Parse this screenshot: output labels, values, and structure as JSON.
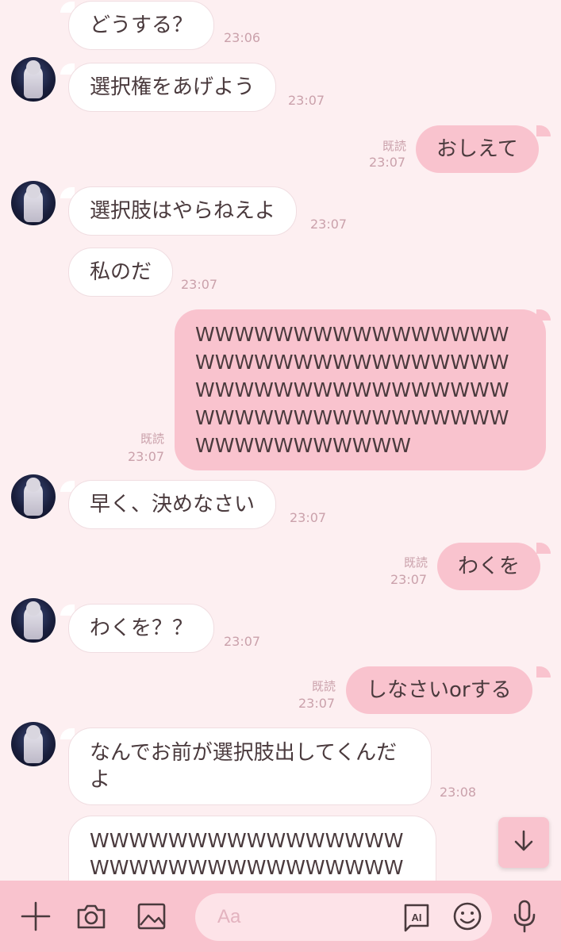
{
  "messages": [
    {
      "side": "in",
      "text": "どうする？",
      "time": "23:06"
    },
    {
      "side": "in",
      "text": "選択権をあげよう",
      "time": "23:07"
    },
    {
      "side": "out",
      "text": "おしえて",
      "time": "23:07",
      "read": "既読"
    },
    {
      "side": "in",
      "text": "選択肢はやらねえよ",
      "time": "23:07"
    },
    {
      "side": "in",
      "text": "私のだ",
      "time": "23:07"
    },
    {
      "side": "out",
      "text": "WWWWWWWWWWWWWWWWWWWWWWWWWWWWWWWWWWWWWWWWWWWWWWWWWWWWWWWWWWWWWWWWWWWWWWWWWWW",
      "time": "23:07",
      "read": "既読"
    },
    {
      "side": "in",
      "text": "早く、決めなさい",
      "time": "23:07"
    },
    {
      "side": "out",
      "text": "わくを",
      "time": "23:07",
      "read": "既読"
    },
    {
      "side": "in",
      "text": "わくを？？",
      "time": "23:07"
    },
    {
      "side": "out",
      "text": "しなさいorする",
      "time": "23:07",
      "read": "既読"
    },
    {
      "side": "in",
      "text": "なんでお前が選択肢出してくんだよ",
      "time": "23:08"
    },
    {
      "side": "in",
      "text": "WWWWWWWWWWWWWWWWWWWWWWWWWWWWWWWWWW"
    }
  ],
  "input": {
    "placeholder": "Aa"
  },
  "icons": {
    "plus": "plus-icon",
    "camera": "camera-icon",
    "image": "image-icon",
    "ai": "ai-icon",
    "emoji": "emoji-icon",
    "mic": "microphone-icon",
    "scroll": "arrow-down-icon"
  },
  "ai_label": "AI",
  "colors": {
    "background": "#fdeff1",
    "outgoing": "#f9c3ce",
    "incoming": "#ffffff",
    "timestamp": "#caa1ab"
  }
}
